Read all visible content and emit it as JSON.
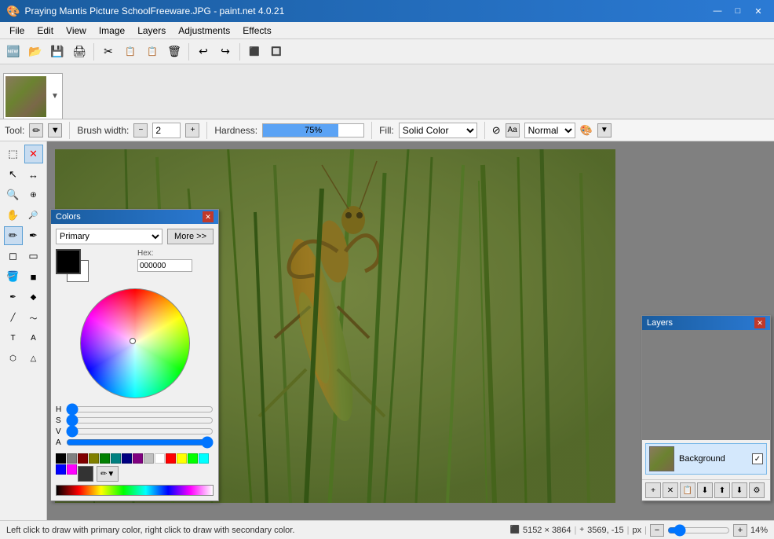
{
  "titlebar": {
    "title": "Praying Mantis Picture SchoolFreeware.JPG - paint.net 4.0.21",
    "minimize_label": "—",
    "maximize_label": "□",
    "close_label": "✕"
  },
  "menubar": {
    "items": [
      "File",
      "Edit",
      "View",
      "Image",
      "Layers",
      "Adjustments",
      "Effects"
    ]
  },
  "toolbar": {
    "buttons": [
      "🆕",
      "📂",
      "💾",
      "🖨",
      "✂",
      "📋",
      "📋",
      "🗑",
      "↩",
      "↪",
      "⬛",
      "🔲"
    ]
  },
  "image_tab": {
    "filename": "Praying Mantis Picture SchoolFreeware.JPG",
    "dropdown_symbol": "▼"
  },
  "options_bar": {
    "tool_label": "Tool:",
    "brush_width_label": "Brush width:",
    "brush_width_value": "2",
    "hardness_label": "Hardness:",
    "hardness_value": "75%",
    "hardness_percent": 75,
    "fill_label": "Fill:",
    "fill_value": "Solid Color",
    "blend_mode_value": "Normal"
  },
  "tools": {
    "rows": [
      [
        "T",
        "✕"
      ],
      [
        "↖",
        "↔"
      ],
      [
        "🔍",
        "⊕"
      ],
      [
        "✋",
        "🔍"
      ],
      [
        "🖊",
        "✒"
      ],
      [
        "⬚",
        "⬜"
      ],
      [
        "🪣",
        "■"
      ],
      [
        "✏",
        "◻"
      ],
      [
        "📐",
        "✏"
      ],
      [
        "T",
        "A"
      ],
      [
        "⬡",
        "△"
      ]
    ]
  },
  "colors_panel": {
    "title": "Colors",
    "close_label": "✕",
    "primary_label": "Primary",
    "more_label": "More >>",
    "fg_color": "#000000",
    "bg_color": "#ffffff",
    "palette": [
      "#000000",
      "#808080",
      "#800000",
      "#808000",
      "#008000",
      "#008080",
      "#000080",
      "#800080",
      "#ffffff",
      "#c0c0c0",
      "#ff0000",
      "#ffff00",
      "#00ff00",
      "#00ffff",
      "#0000ff",
      "#ff00ff",
      "#ff8040",
      "#ff8080",
      "#ffd700",
      "#80ff00",
      "#40ffff",
      "#8080ff",
      "#ff80ff",
      "#ff4080"
    ]
  },
  "layers_panel": {
    "title": "Layers",
    "close_label": "✕",
    "layers": [
      {
        "name": "Background",
        "visible": true
      }
    ],
    "toolbar_buttons": [
      "+",
      "✕",
      "📋",
      "⬆",
      "⬇",
      "⚙"
    ]
  },
  "statusbar": {
    "message": "Left click to draw with primary color, right click to draw with secondary color.",
    "dimensions": "5152 × 3864",
    "cursor_pos": "3569, -15",
    "unit": "px",
    "zoom": "14%"
  }
}
